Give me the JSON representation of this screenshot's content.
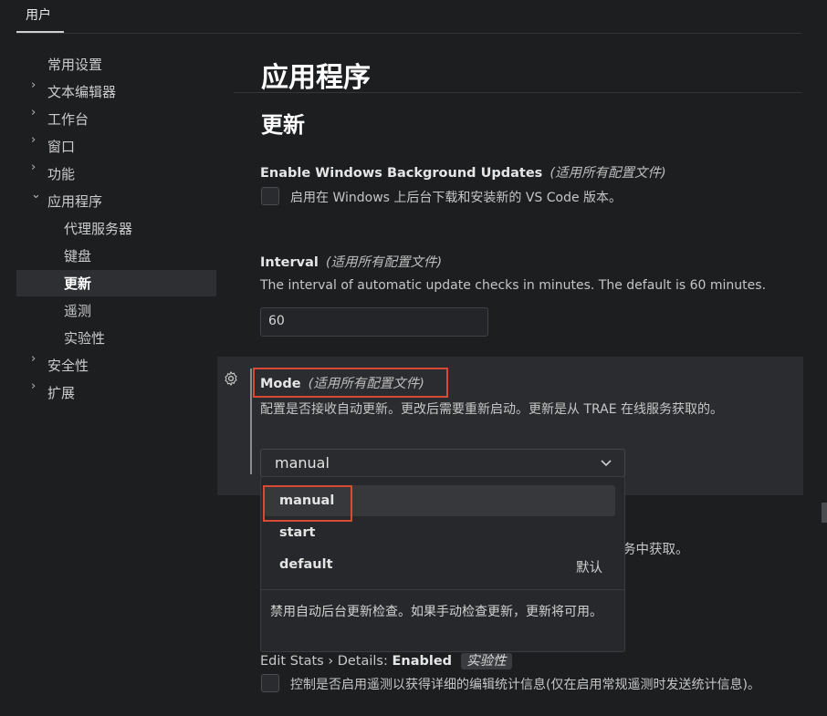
{
  "header": {
    "user_tab": "用户"
  },
  "sidebar": {
    "items": [
      {
        "label": "常用设置"
      },
      {
        "label": "文本编辑器"
      },
      {
        "label": "工作台"
      },
      {
        "label": "窗口"
      },
      {
        "label": "功能"
      },
      {
        "label": "应用程序"
      },
      {
        "label": "代理服务器"
      },
      {
        "label": "键盘"
      },
      {
        "label": "更新"
      },
      {
        "label": "遥测"
      },
      {
        "label": "实验性"
      },
      {
        "label": "安全性"
      },
      {
        "label": "扩展"
      }
    ]
  },
  "main": {
    "section_title": "应用程序",
    "subsection_title": "更新",
    "settings": {
      "bg_updates": {
        "title": "Enable Windows Background Updates",
        "scope": "(适用所有配置文件)",
        "description": "启用在 Windows 上后台下载和安装新的 VS Code 版本。"
      },
      "interval": {
        "title": "Interval",
        "scope": "(适用所有配置文件)",
        "description": "The interval of automatic update checks in minutes. The default is 60 minutes.",
        "value": "60"
      },
      "mode": {
        "title": "Mode",
        "scope": "(适用所有配置文件)",
        "description": "配置是否接收自动更新。更改后需要重新启动。更新是从 TRAE 在线服务获取的。",
        "selected": "manual",
        "options": [
          {
            "label": "manual"
          },
          {
            "label": "start"
          },
          {
            "label": "default",
            "tag": "默认"
          }
        ],
        "option_description": "禁用自动后台更新检查。如果手动检查更新，更新将可用。"
      },
      "obscured": {
        "visible_text": "务中获取。"
      },
      "edit_stats": {
        "breadcrumb": "Edit Stats › Details: ",
        "title": "Enabled",
        "badge": "实验性",
        "description": "控制是否启用遥测以获得详细的编辑统计信息(仅在启用常规遥测时发送统计信息)。"
      }
    }
  },
  "colors": {
    "highlight_border": "#d84a35",
    "background": "#1d1e20"
  }
}
